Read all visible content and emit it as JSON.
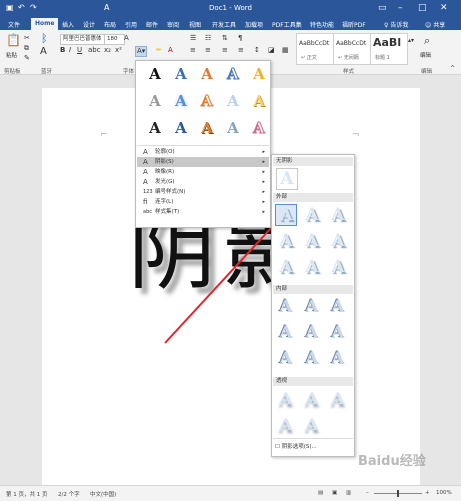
{
  "app": {
    "title": "Doc1 - Word",
    "share": "共享",
    "help_prompt": "告诉我"
  },
  "tabs": [
    {
      "label": "文件"
    },
    {
      "label": "Home"
    },
    {
      "label": "插入"
    },
    {
      "label": "设计"
    },
    {
      "label": "布局"
    },
    {
      "label": "引用"
    },
    {
      "label": "邮件"
    },
    {
      "label": "审阅"
    },
    {
      "label": "视图"
    },
    {
      "label": "开发工具"
    },
    {
      "label": "加载项"
    },
    {
      "label": "PDF工具集"
    },
    {
      "label": "特色功能"
    },
    {
      "label": "福昕PDF"
    }
  ],
  "ribbon": {
    "paste": "粘贴",
    "clipboard": "剪贴板",
    "bluetooth": "蓝牙",
    "font_name": "阿里巴巴普惠体",
    "font_size": "180",
    "font_group": "字体",
    "styles_group": "样式",
    "styles": [
      {
        "preview": "AaBbCcDt",
        "name": "↵ 正文"
      },
      {
        "preview": "AaBbCcDt",
        "name": "↵ 无间隔"
      },
      {
        "preview": "AaBl",
        "name": "标题 1"
      }
    ],
    "edit": "编辑",
    "edit_group": "编辑"
  },
  "document": {
    "chars": [
      "阴",
      "影"
    ]
  },
  "effects_menu": {
    "items": [
      {
        "icon": "A",
        "label": "轮廓(O)"
      },
      {
        "icon": "A",
        "label": "阴影(S)"
      },
      {
        "icon": "A",
        "label": "映像(R)"
      },
      {
        "icon": "A",
        "label": "发光(G)"
      },
      {
        "icon": "123",
        "label": "编号样式(N)"
      },
      {
        "icon": "fi",
        "label": "连字(L)"
      },
      {
        "icon": "abc",
        "label": "样式集(T)"
      }
    ]
  },
  "shadow_panel": {
    "no_shadow": "无阴影",
    "outer": "外部",
    "inner": "内部",
    "perspective": "透视",
    "options": "阴影选项(S)..."
  },
  "statusbar": {
    "page": "第 1 页，共 1 页",
    "words": "2/2 个字",
    "lang": "中文(中国)",
    "zoom": "100%"
  },
  "colors": {
    "brand": "#2b579a",
    "arrow": "#e0262b",
    "selection": "#5b8ed6"
  },
  "watermark": "Baidu经验"
}
